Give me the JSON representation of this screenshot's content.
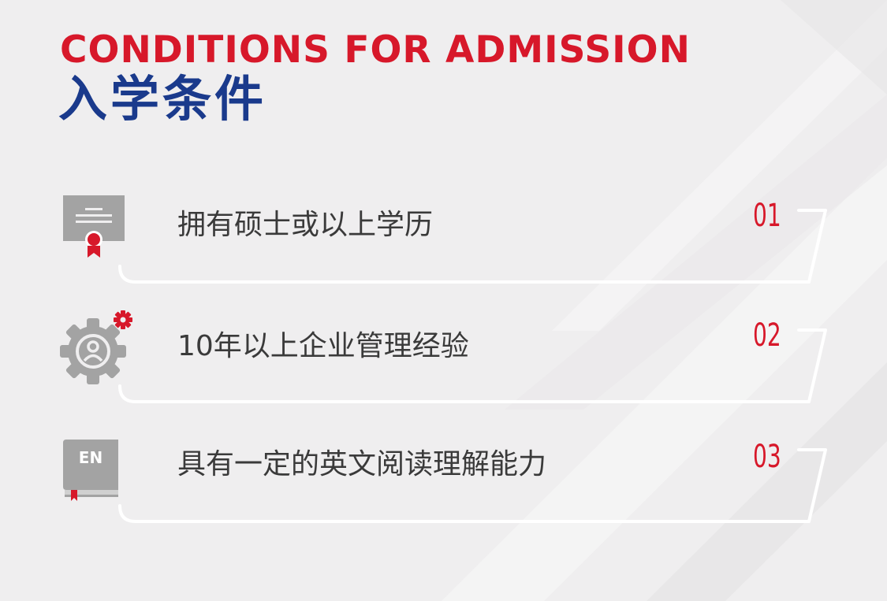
{
  "header": {
    "title_en": "CONDITIONS FOR ADMISSION",
    "title_cn": "入学条件"
  },
  "items": [
    {
      "number": "01",
      "text": "拥有硕士或以上学历",
      "icon": "certificate-icon"
    },
    {
      "number": "02",
      "text": "10年以上企业管理经验",
      "icon": "gear-person-icon"
    },
    {
      "number": "03",
      "text": "具有一定的英文阅读理解能力",
      "icon": "english-book-icon"
    }
  ],
  "book_label": "EN",
  "colors": {
    "accent_red": "#d7182a",
    "accent_blue": "#1a3a8c",
    "text": "#3a3a3a",
    "icon_gray": "#a3a3a3",
    "background": "#efeeef"
  }
}
